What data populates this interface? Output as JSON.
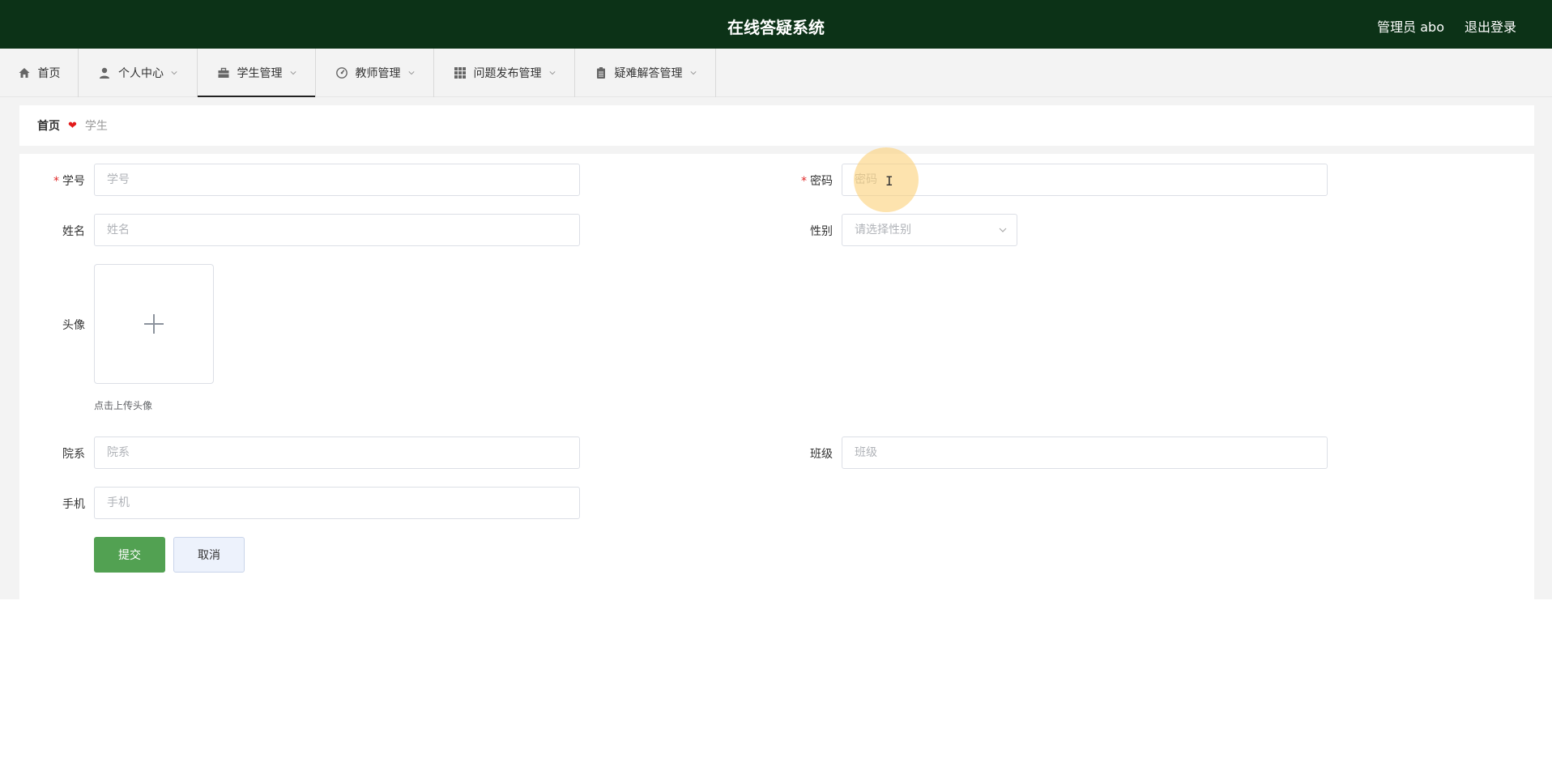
{
  "header": {
    "title": "在线答疑系统",
    "user": "管理员 abo",
    "logout": "退出登录"
  },
  "nav": {
    "items": [
      {
        "label": "首页",
        "icon": "home-icon"
      },
      {
        "label": "个人中心",
        "icon": "user-icon"
      },
      {
        "label": "学生管理",
        "icon": "briefcase-icon",
        "active": true
      },
      {
        "label": "教师管理",
        "icon": "gauge-icon"
      },
      {
        "label": "问题发布管理",
        "icon": "grid-icon"
      },
      {
        "label": "疑难解答管理",
        "icon": "clipboard-icon"
      }
    ]
  },
  "breadcrumb": {
    "home": "首页",
    "current": "学生"
  },
  "form": {
    "student_id": {
      "label": "学号",
      "placeholder": "学号",
      "required": true
    },
    "password": {
      "label": "密码",
      "placeholder": "密码",
      "required": true
    },
    "name": {
      "label": "姓名",
      "placeholder": "姓名"
    },
    "gender": {
      "label": "性别",
      "placeholder": "请选择性别"
    },
    "avatar": {
      "label": "头像",
      "tip": "点击上传头像"
    },
    "department": {
      "label": "院系",
      "placeholder": "院系"
    },
    "class": {
      "label": "班级",
      "placeholder": "班级"
    },
    "phone": {
      "label": "手机",
      "placeholder": "手机"
    },
    "submit": "提交",
    "cancel": "取消"
  },
  "colors": {
    "header_bg": "#0c3217",
    "submit_bg": "#52a152",
    "required": "#e02828"
  }
}
